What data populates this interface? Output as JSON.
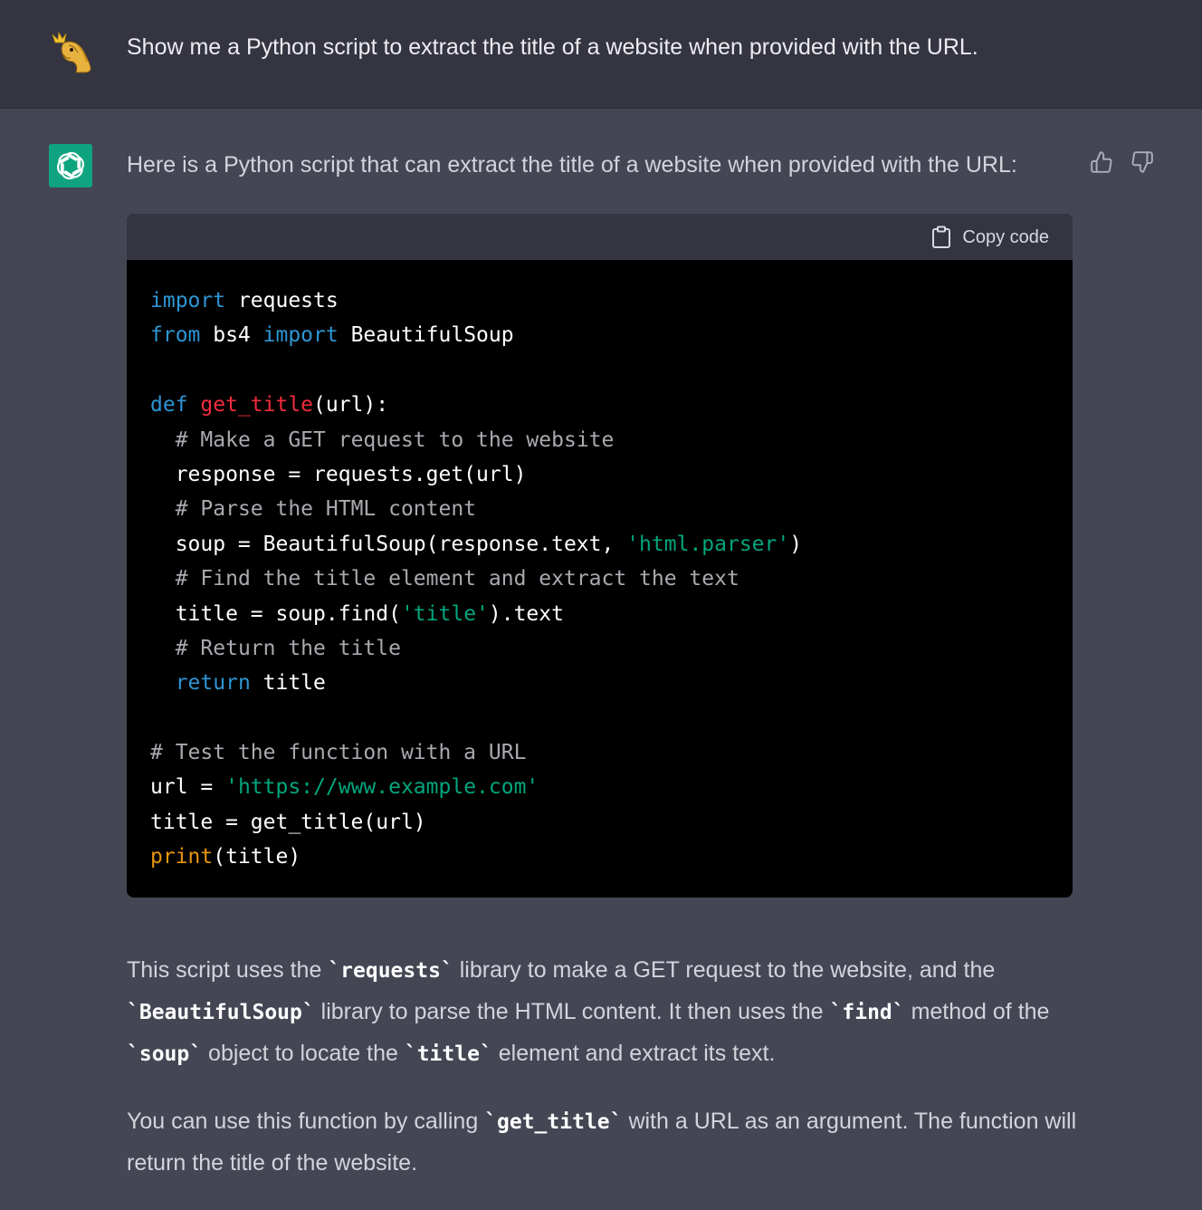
{
  "user": {
    "avatar_icon": "user-avatar-icon",
    "message": "Show me a Python script to extract the title of a website when provided with the URL."
  },
  "assistant": {
    "avatar_icon": "openai-logo-icon",
    "intro": "Here is a Python script that can extract the title of a website when provided with the URL:",
    "feedback": {
      "up_icon": "thumbs-up-icon",
      "down_icon": "thumbs-down-icon"
    },
    "code_block": {
      "copy_icon": "clipboard-icon",
      "copy_label": "Copy code",
      "lines": [
        [
          {
            "t": "kw",
            "v": "import"
          },
          {
            "t": "",
            "v": " requests"
          }
        ],
        [
          {
            "t": "kw",
            "v": "from"
          },
          {
            "t": "",
            "v": " bs4 "
          },
          {
            "t": "kw",
            "v": "import"
          },
          {
            "t": "",
            "v": " BeautifulSoup"
          }
        ],
        [],
        [
          {
            "t": "kw",
            "v": "def"
          },
          {
            "t": "",
            "v": " "
          },
          {
            "t": "fn",
            "v": "get_title"
          },
          {
            "t": "",
            "v": "(url):"
          }
        ],
        [
          {
            "t": "",
            "v": "  "
          },
          {
            "t": "cm",
            "v": "# Make a GET request to the website"
          }
        ],
        [
          {
            "t": "",
            "v": "  response = requests.get(url)"
          }
        ],
        [
          {
            "t": "",
            "v": "  "
          },
          {
            "t": "cm",
            "v": "# Parse the HTML content"
          }
        ],
        [
          {
            "t": "",
            "v": "  soup = BeautifulSoup(response.text, "
          },
          {
            "t": "str",
            "v": "'html.parser'"
          },
          {
            "t": "",
            "v": ")"
          }
        ],
        [
          {
            "t": "",
            "v": "  "
          },
          {
            "t": "cm",
            "v": "# Find the title element and extract the text"
          }
        ],
        [
          {
            "t": "",
            "v": "  title = soup.find("
          },
          {
            "t": "str",
            "v": "'title'"
          },
          {
            "t": "",
            "v": ").text"
          }
        ],
        [
          {
            "t": "",
            "v": "  "
          },
          {
            "t": "cm",
            "v": "# Return the title"
          }
        ],
        [
          {
            "t": "",
            "v": "  "
          },
          {
            "t": "kw",
            "v": "return"
          },
          {
            "t": "",
            "v": " title"
          }
        ],
        [],
        [
          {
            "t": "cm",
            "v": "# Test the function with a URL"
          }
        ],
        [
          {
            "t": "",
            "v": "url = "
          },
          {
            "t": "str",
            "v": "'https://www.example.com'"
          }
        ],
        [
          {
            "t": "",
            "v": "title = get_title(url)"
          }
        ],
        [
          {
            "t": "bi",
            "v": "print"
          },
          {
            "t": "",
            "v": "(title)"
          }
        ]
      ]
    },
    "explanation": [
      [
        {
          "t": "text",
          "v": "This script uses the "
        },
        {
          "t": "code",
          "v": "`requests`"
        },
        {
          "t": "text",
          "v": " library to make a GET request to the website, and the "
        },
        {
          "t": "code",
          "v": "`BeautifulSoup`"
        },
        {
          "t": "text",
          "v": " library to parse the HTML content. It then uses the "
        },
        {
          "t": "code",
          "v": "`find`"
        },
        {
          "t": "text",
          "v": " method of the "
        },
        {
          "t": "code",
          "v": "`soup`"
        },
        {
          "t": "text",
          "v": " object to locate the "
        },
        {
          "t": "code",
          "v": "`title`"
        },
        {
          "t": "text",
          "v": " element and extract its text."
        }
      ],
      [
        {
          "t": "text",
          "v": "You can use this function by calling "
        },
        {
          "t": "code",
          "v": "`get_title`"
        },
        {
          "t": "text",
          "v": " with a URL as an argument. The function will return the title of the website."
        }
      ]
    ]
  },
  "colors": {
    "page_bg": "#444654",
    "user_row_bg": "#343541",
    "code_bg": "#000000",
    "code_header_bg": "#343541",
    "brand_green": "#10a37f",
    "keyword": "#2e95d3",
    "function_name": "#f22c3d",
    "string": "#00a67d",
    "comment": "#a9aab0",
    "builtin": "#e9950c"
  }
}
